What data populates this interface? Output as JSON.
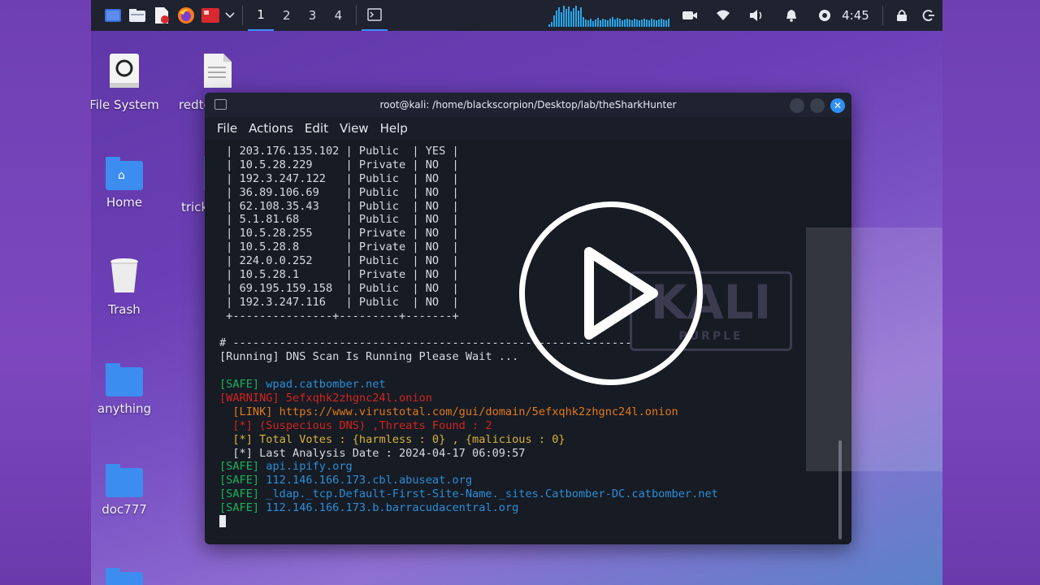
{
  "panel": {
    "workspaces": [
      "1",
      "2",
      "3",
      "4"
    ],
    "active_workspace": "1",
    "clock": "4:45",
    "icons": [
      "kali-menu-icon",
      "file-manager-icon",
      "text-editor-icon",
      "firefox-icon",
      "terminal-red-icon",
      "chevron-down-icon",
      "terminal-icon",
      "camera-icon",
      "wifi-icon",
      "volume-icon",
      "bell-icon",
      "power-manager-icon",
      "lock-icon",
      "logout-icon"
    ]
  },
  "desktop": {
    "icons": [
      {
        "label": "File System",
        "icon": "drive-icon"
      },
      {
        "label": "redte",
        "icon": "document-icon"
      },
      {
        "label": "Home",
        "icon": "home-folder-icon"
      },
      {
        "label": "trick",
        "icon": "document-icon"
      },
      {
        "label": "Trash",
        "icon": "trash-icon"
      },
      {
        "label": "anything",
        "icon": "folder-icon"
      },
      {
        "label": "doc777",
        "icon": "folder-icon"
      }
    ]
  },
  "terminal": {
    "title": "root@kali: /home/blackscorpion/Desktop/lab/theSharkHunter",
    "menu": [
      "File",
      "Actions",
      "Edit",
      "View",
      "Help"
    ],
    "table_rows": [
      [
        "203.176.135.102",
        "Public",
        "YES"
      ],
      [
        "10.5.28.229",
        "Private",
        "NO"
      ],
      [
        "192.3.247.122",
        "Public",
        "NO"
      ],
      [
        "36.89.106.69",
        "Public",
        "NO"
      ],
      [
        "62.108.35.43",
        "Public",
        "NO"
      ],
      [
        "5.1.81.68",
        "Public",
        "NO"
      ],
      [
        "10.5.28.255",
        "Private",
        "NO"
      ],
      [
        "10.5.28.8",
        "Private",
        "NO"
      ],
      [
        "224.0.0.252",
        "Public",
        "NO"
      ],
      [
        "10.5.28.1",
        "Private",
        "NO"
      ],
      [
        "69.195.159.158",
        "Public",
        "NO"
      ],
      [
        "192.3.247.116",
        "Public",
        "NO"
      ]
    ],
    "table_footer": "+---------------+---------+-------+",
    "separator": "# ------------------------------------------------------------",
    "running": "[Running] DNS Scan Is Running Please Wait ...",
    "results": [
      {
        "tag": "[SAFE]",
        "text": "wpad.catbomber.net"
      },
      {
        "tag": "[WARNING]",
        "text": "5efxqhk2zhgnc24l.onion"
      }
    ],
    "details": [
      {
        "tag": "[LINK]",
        "text": "https://www.virustotal.com/gui/domain/5efxqhk2zhgnc24l.onion"
      },
      {
        "tag": "[*]",
        "text": "(Suspecious DNS) ,Threats Found : 2"
      },
      {
        "tag": "[*]",
        "text": "Total Votes : {harmless : 0} , {malicious : 0}"
      },
      {
        "tag": "[*]",
        "text": "Last Analysis Date : 2024-04-17 06:09:57"
      }
    ],
    "safe_results": [
      "api.ipify.org",
      "112.146.166.173.cbl.abuseat.org",
      "_ldap._tcp.Default-First-Site-Name._sites.Catbomber-DC.catbomber.net",
      "112.146.166.173.b.barracudacentral.org"
    ],
    "safe_tag": "[SAFE]",
    "watermark": "KALI",
    "watermark_sub": "PURPLE"
  },
  "colors": {
    "safe": "#19b35a",
    "host": "#2a8fd8",
    "warning": "#d4241c",
    "link": "#e07a1a",
    "votes": "#d6b23a",
    "accent": "#3d8eff"
  }
}
